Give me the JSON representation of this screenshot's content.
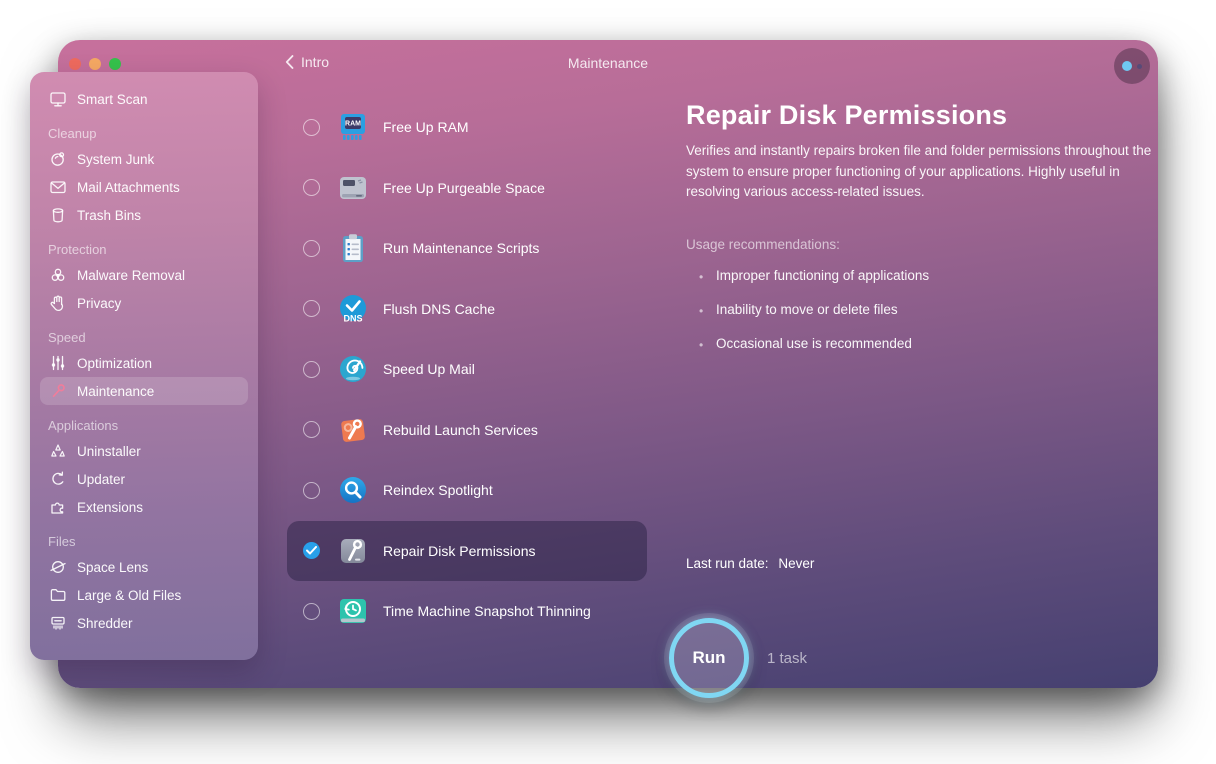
{
  "titlebar": {
    "back_label": "Intro",
    "title": "Maintenance"
  },
  "sidebar": {
    "sections": [
      {
        "header": "",
        "items": [
          {
            "icon": "smart-scan-icon",
            "label": "Smart Scan"
          }
        ]
      },
      {
        "header": "Cleanup",
        "items": [
          {
            "icon": "system-junk-icon",
            "label": "System Junk"
          },
          {
            "icon": "mail-attachments-icon",
            "label": "Mail Attachments"
          },
          {
            "icon": "trash-bins-icon",
            "label": "Trash Bins"
          }
        ]
      },
      {
        "header": "Protection",
        "items": [
          {
            "icon": "malware-removal-icon",
            "label": "Malware Removal"
          },
          {
            "icon": "privacy-icon",
            "label": "Privacy"
          }
        ]
      },
      {
        "header": "Speed",
        "items": [
          {
            "icon": "optimization-icon",
            "label": "Optimization"
          },
          {
            "icon": "maintenance-icon",
            "label": "Maintenance",
            "active": true
          }
        ]
      },
      {
        "header": "Applications",
        "items": [
          {
            "icon": "uninstaller-icon",
            "label": "Uninstaller"
          },
          {
            "icon": "updater-icon",
            "label": "Updater"
          },
          {
            "icon": "extensions-icon",
            "label": "Extensions"
          }
        ]
      },
      {
        "header": "Files",
        "items": [
          {
            "icon": "space-lens-icon",
            "label": "Space Lens"
          },
          {
            "icon": "large-old-files-icon",
            "label": "Large & Old Files"
          },
          {
            "icon": "shredder-icon",
            "label": "Shredder"
          }
        ]
      }
    ]
  },
  "tasks": [
    {
      "icon": "free-up-ram-icon",
      "label": "Free Up RAM",
      "selected": false
    },
    {
      "icon": "free-up-purgeable-space-icon",
      "label": "Free Up Purgeable Space",
      "selected": false
    },
    {
      "icon": "run-maintenance-scripts-icon",
      "label": "Run Maintenance Scripts",
      "selected": false
    },
    {
      "icon": "flush-dns-cache-icon",
      "label": "Flush DNS Cache",
      "selected": false
    },
    {
      "icon": "speed-up-mail-icon",
      "label": "Speed Up Mail",
      "selected": false
    },
    {
      "icon": "rebuild-launch-services-icon",
      "label": "Rebuild Launch Services",
      "selected": false
    },
    {
      "icon": "reindex-spotlight-icon",
      "label": "Reindex Spotlight",
      "selected": false
    },
    {
      "icon": "repair-disk-permissions-icon",
      "label": "Repair Disk Permissions",
      "selected": true
    },
    {
      "icon": "time-machine-snapshot-thinning-icon",
      "label": "Time Machine Snapshot Thinning",
      "selected": false
    }
  ],
  "detail": {
    "title": "Repair Disk Permissions",
    "description": "Verifies and instantly repairs broken file and folder permissions throughout the system to ensure proper functioning of your applications. Highly useful in resolving various access-related issues.",
    "usage_title": "Usage recommendations:",
    "usage_items": [
      "Improper functioning of applications",
      "Inability to move or delete files",
      "Occasional use is recommended"
    ],
    "last_run_label": "Last run date:",
    "last_run_value": "Never",
    "run_label": "Run",
    "task_count": "1 task"
  },
  "colors": {
    "gradient_top": "#c7709c",
    "gradient_bottom": "#454070",
    "run_ring_accent": "#80d7f3",
    "checkbox_checked": "#28a0ea",
    "traffic_red": "#ee6a5e",
    "traffic_orange": "#f5a863",
    "traffic_green": "#35c24b"
  }
}
